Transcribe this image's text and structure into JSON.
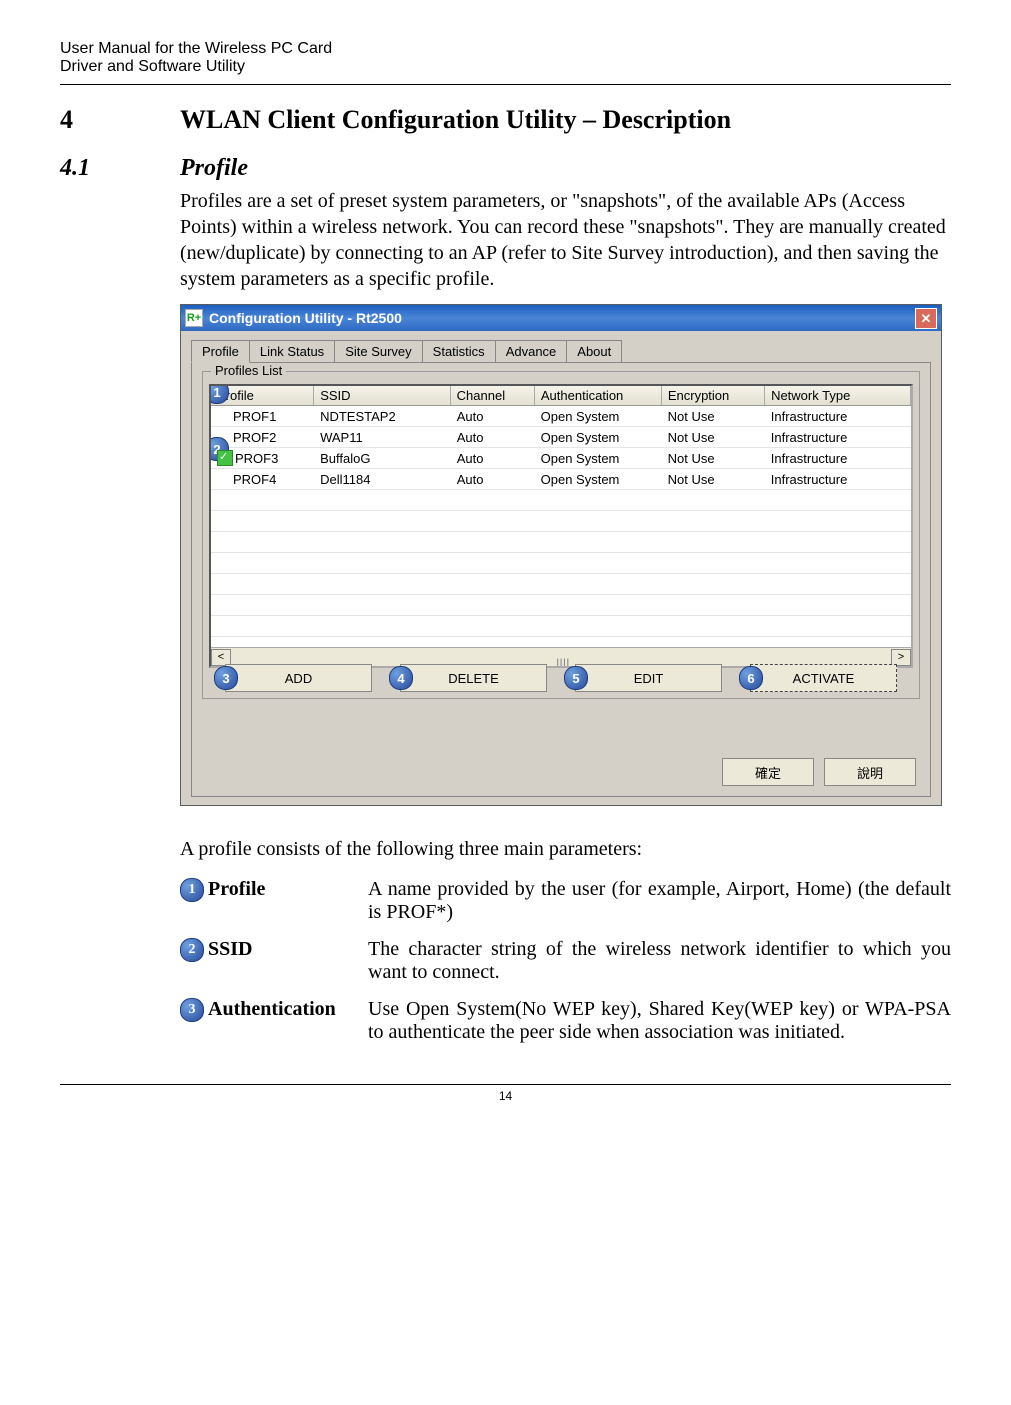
{
  "header": {
    "line1": "User Manual for the Wireless PC Card",
    "line2": "Driver and Software Utility"
  },
  "section": {
    "num": "4",
    "title": "WLAN Client Configuration Utility – Description"
  },
  "subsection": {
    "num": "4.1",
    "title": "Profile",
    "intro": "Profiles are a set of preset system parameters, or \"snapshots\", of the available APs (Access Points) within a wireless network. You can record these \"snapshots\". They are manually created (new/duplicate) by connecting to an AP (refer to Site Survey introduction), and then saving the system parameters as a specific profile."
  },
  "window": {
    "title": "Configuration Utility - Rt2500",
    "appicon_label": "R+",
    "tabs": {
      "t0": "Profile",
      "t1": "Link Status",
      "t2": "Site Survey",
      "t3": "Statistics",
      "t4": "Advance",
      "t5": "About"
    },
    "group_label": "Profiles List",
    "columns": {
      "c0": "Profile",
      "c1": "SSID",
      "c2": "Channel",
      "c3": "Authentication",
      "c4": "Encryption",
      "c5": "Network Type"
    },
    "rows": [
      {
        "profile": "PROF1",
        "ssid": "NDTESTAP2",
        "channel": "Auto",
        "auth": "Open System",
        "enc": "Not Use",
        "net": "Infrastructure",
        "active": false
      },
      {
        "profile": "PROF2",
        "ssid": "WAP11",
        "channel": "Auto",
        "auth": "Open System",
        "enc": "Not Use",
        "net": "Infrastructure",
        "active": false
      },
      {
        "profile": "PROF3",
        "ssid": "BuffaloG",
        "channel": "Auto",
        "auth": "Open System",
        "enc": "Not Use",
        "net": "Infrastructure",
        "active": true
      },
      {
        "profile": "PROF4",
        "ssid": "Dell1184",
        "channel": "Auto",
        "auth": "Open System",
        "enc": "Not Use",
        "net": "Infrastructure",
        "active": false
      }
    ],
    "buttons": {
      "add": "ADD",
      "delete": "DELETE",
      "edit": "EDIT",
      "activate": "ACTIVATE"
    },
    "bubbles": {
      "b1": "1",
      "b2": "2",
      "b3": "3",
      "b4": "4",
      "b5": "5",
      "b6": "6"
    },
    "bottom": {
      "ok": "確定",
      "help": "說明"
    },
    "scroll": {
      "left": "<",
      "right": ">",
      "thumb": "||||"
    }
  },
  "after_intro": "A profile consists of the following three main parameters:",
  "definitions": {
    "d1": {
      "num": "1",
      "term": "Profile",
      "desc": "A name provided by the user (for example, Airport, Home) (the default is PROF*)"
    },
    "d2": {
      "num": "2",
      "term": "SSID",
      "desc": "The character string of the wireless network identifier to which you want to connect."
    },
    "d3": {
      "num": "3",
      "term": "Authentication",
      "desc": "Use Open System(No WEP key), Shared Key(WEP key) or WPA-PSA to authenticate the peer side when association was initiated."
    }
  },
  "footer": {
    "page": "14"
  }
}
